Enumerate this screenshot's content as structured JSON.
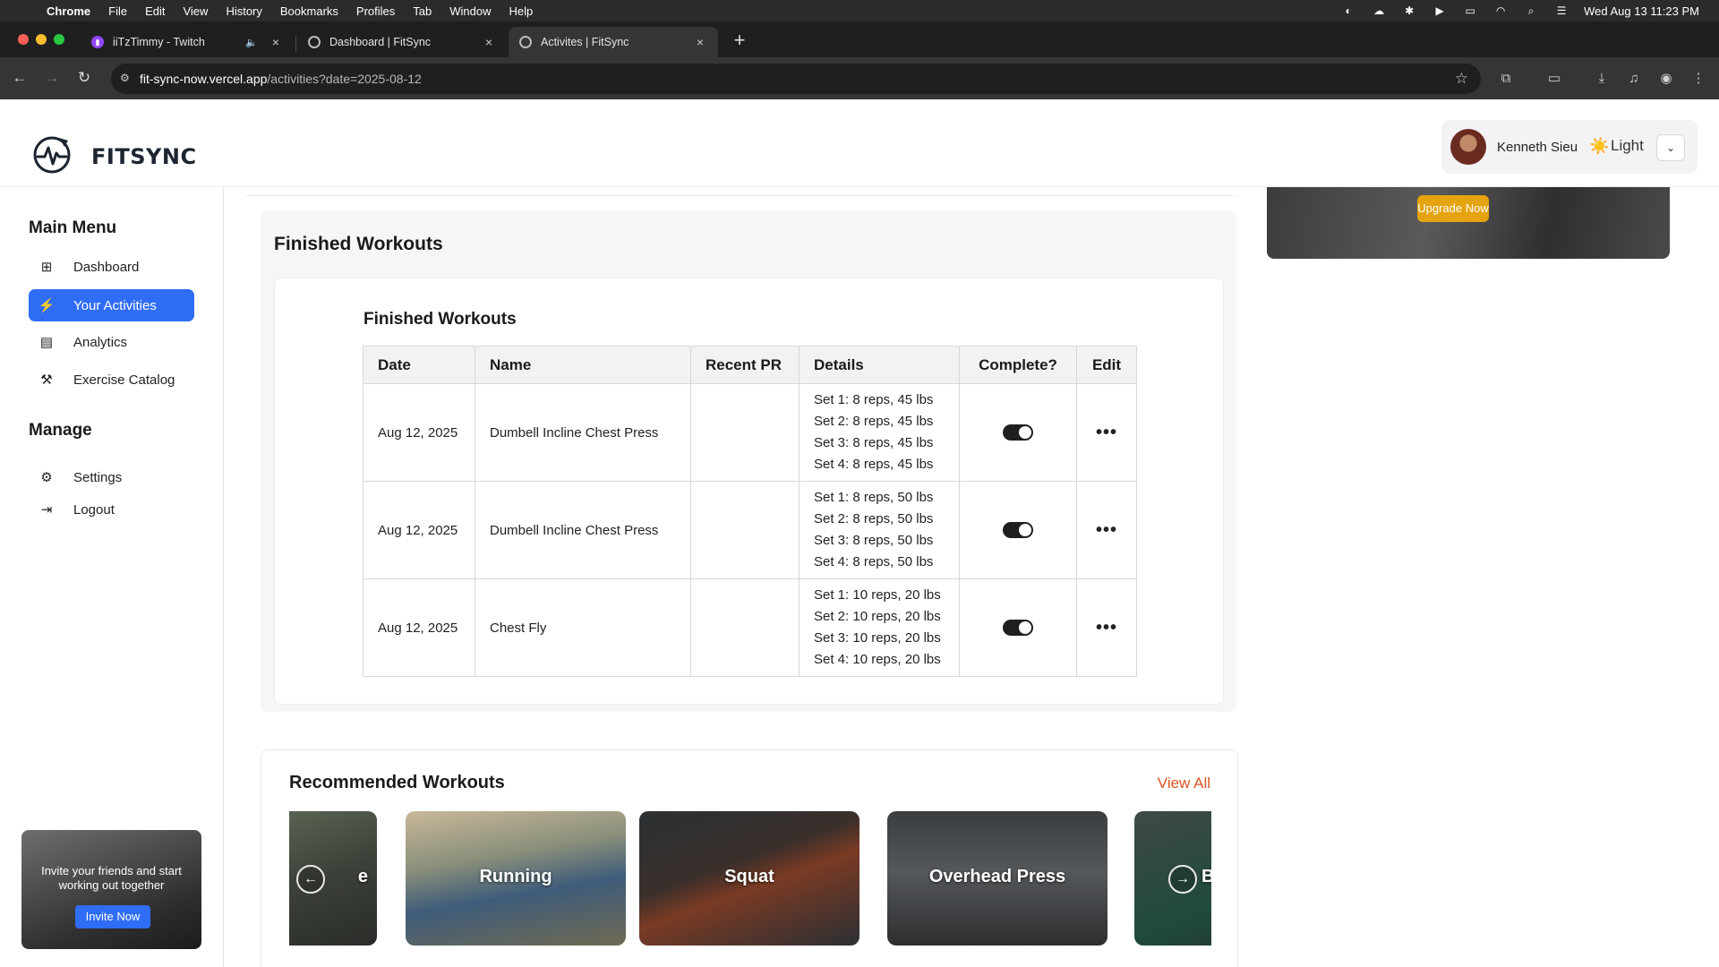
{
  "menubar": {
    "app": "Chrome",
    "items": [
      "File",
      "Edit",
      "View",
      "History",
      "Bookmarks",
      "Profiles",
      "Tab",
      "Window",
      "Help"
    ],
    "datetime": "Wed Aug 13  11:23 PM"
  },
  "browser": {
    "tabs": [
      {
        "title": "iiTzTimmy - Twitch"
      },
      {
        "title": "Dashboard | FitSync"
      },
      {
        "title": "Activites | FitSync"
      }
    ],
    "url_host": "fit-sync-now.vercel.app",
    "url_path": "/activities?date=2025-08-12"
  },
  "app": {
    "brand": "FITSYNC",
    "user_name": "Kenneth Sieu",
    "theme_label": "Light",
    "theme_icon": "☀️"
  },
  "sidebar": {
    "main_heading": "Main Menu",
    "main_items": [
      {
        "label": "Dashboard",
        "icon": "grid-icon"
      },
      {
        "label": "Your Activities",
        "icon": "run-icon",
        "active": true
      },
      {
        "label": "Analytics",
        "icon": "chart-icon"
      },
      {
        "label": "Exercise Catalog",
        "icon": "dumbbell-icon"
      }
    ],
    "manage_heading": "Manage",
    "manage_items": [
      {
        "label": "Settings",
        "icon": "gear-icon"
      },
      {
        "label": "Logout",
        "icon": "logout-icon"
      }
    ],
    "invite_text": "Invite your friends and start working out together",
    "invite_button": "Invite Now"
  },
  "promo": {
    "button": "Upgrade Now"
  },
  "finished": {
    "panel_title": "Finished Workouts",
    "card_title": "Finished Workouts",
    "columns": [
      "Date",
      "Name",
      "Recent PR",
      "Details",
      "Complete?",
      "Edit"
    ],
    "rows": [
      {
        "date": "Aug 12, 2025",
        "name": "Dumbell Incline Chest Press",
        "pr": "",
        "sets": [
          "Set 1: 8 reps, 45 lbs",
          "Set 2: 8 reps, 45 lbs",
          "Set 3: 8 reps, 45 lbs",
          "Set 4: 8 reps, 45 lbs"
        ],
        "complete": true
      },
      {
        "date": "Aug 12, 2025",
        "name": "Dumbell Incline Chest Press",
        "pr": "",
        "sets": [
          "Set 1: 8 reps, 50 lbs",
          "Set 2: 8 reps, 50 lbs",
          "Set 3: 8 reps, 50 lbs",
          "Set 4: 8 reps, 50 lbs"
        ],
        "complete": true
      },
      {
        "date": "Aug 12, 2025",
        "name": "Chest Fly",
        "pr": "",
        "sets": [
          "Set 1: 10 reps, 20 lbs",
          "Set 2: 10 reps, 20 lbs",
          "Set 3: 10 reps, 20 lbs",
          "Set 4: 10 reps, 20 lbs"
        ],
        "complete": true
      }
    ]
  },
  "recommended": {
    "title": "Recommended Workouts",
    "view_all": "View All",
    "cards": [
      "Running",
      "Squat",
      "Overhead Press"
    ],
    "partial_label_right": "B",
    "partial_label_left": "e"
  },
  "colors": {
    "accent": "#2f6df6",
    "view_all": "#e0531f",
    "upgrade": "#e5a30f"
  }
}
